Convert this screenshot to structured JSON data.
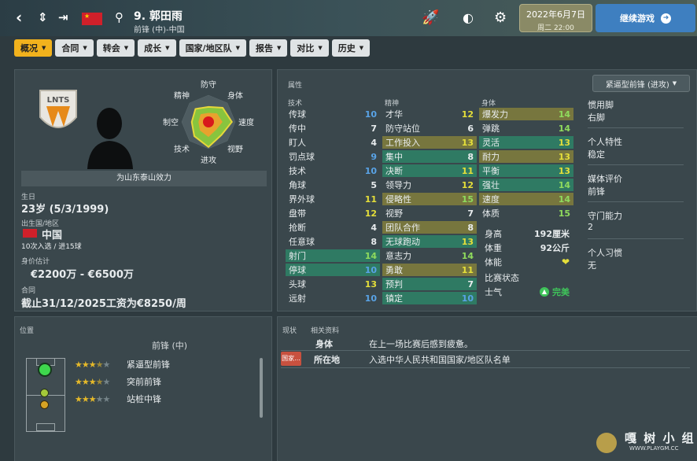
{
  "nav": {
    "back": "‹",
    "updown": "⇕",
    "last": "⇥"
  },
  "player": {
    "name": "9. 郭田雨",
    "subtitle": "前锋 (中)-中国"
  },
  "date": {
    "line1": "2022年6月7日",
    "line2": "周二 22:00"
  },
  "continue": {
    "label": "继续游戏"
  },
  "tabs": [
    "概况",
    "合同",
    "转会",
    "成长",
    "国家/地区队",
    "报告",
    "对比",
    "历史"
  ],
  "left": {
    "club_label": "为山东泰山效力",
    "logo_text": "LNTS",
    "age_title": "生日",
    "age_value": "23岁 (5/3/1999)",
    "nation_title": "出生国/地区",
    "nation_value": "中国",
    "caps": "10次入选 / 进15球",
    "value_title": "身价估计",
    "value": "€2200万 - €6500万",
    "contract_title": "合同",
    "contract": "截止31/12/2025工资为€8250/周"
  },
  "radar": {
    "labels": [
      "防守",
      "身体",
      "速度",
      "视野",
      "进攻",
      "技术",
      "制空",
      "精神"
    ],
    "values": [
      0.45,
      0.6,
      0.7,
      0.55,
      0.75,
      0.6,
      0.5,
      0.55
    ]
  },
  "attributes": {
    "title": "属性",
    "role_select": "紧逼型前锋 (进攻)",
    "technical_title": "技术",
    "technical": [
      {
        "name": "传球",
        "value": "10",
        "color": "b",
        "hl": ""
      },
      {
        "name": "传中",
        "value": "7",
        "color": "w",
        "hl": ""
      },
      {
        "name": "盯人",
        "value": "4",
        "color": "w",
        "hl": ""
      },
      {
        "name": "罚点球",
        "value": "9",
        "color": "b",
        "hl": ""
      },
      {
        "name": "技术",
        "value": "10",
        "color": "b",
        "hl": ""
      },
      {
        "name": "角球",
        "value": "5",
        "color": "w",
        "hl": ""
      },
      {
        "name": "界外球",
        "value": "11",
        "color": "y",
        "hl": ""
      },
      {
        "name": "盘带",
        "value": "12",
        "color": "y",
        "hl": ""
      },
      {
        "name": "抢断",
        "value": "4",
        "color": "w",
        "hl": ""
      },
      {
        "name": "任意球",
        "value": "8",
        "color": "w",
        "hl": ""
      },
      {
        "name": "射门",
        "value": "14",
        "color": "g",
        "hl": "green"
      },
      {
        "name": "停球",
        "value": "10",
        "color": "b",
        "hl": "green"
      },
      {
        "name": "头球",
        "value": "13",
        "color": "y",
        "hl": ""
      },
      {
        "name": "远射",
        "value": "10",
        "color": "b",
        "hl": ""
      }
    ],
    "mental_title": "精神",
    "mental": [
      {
        "name": "才华",
        "value": "12",
        "color": "y",
        "hl": ""
      },
      {
        "name": "防守站位",
        "value": "6",
        "color": "w",
        "hl": ""
      },
      {
        "name": "工作投入",
        "value": "13",
        "color": "y",
        "hl": "yellow"
      },
      {
        "name": "集中",
        "value": "8",
        "color": "w",
        "hl": "green"
      },
      {
        "name": "决断",
        "value": "11",
        "color": "y",
        "hl": "green"
      },
      {
        "name": "领导力",
        "value": "12",
        "color": "y",
        "hl": ""
      },
      {
        "name": "侵略性",
        "value": "15",
        "color": "g",
        "hl": "yellow"
      },
      {
        "name": "视野",
        "value": "7",
        "color": "w",
        "hl": ""
      },
      {
        "name": "团队合作",
        "value": "8",
        "color": "w",
        "hl": "yellow"
      },
      {
        "name": "无球跑动",
        "value": "13",
        "color": "y",
        "hl": "green"
      },
      {
        "name": "意志力",
        "value": "14",
        "color": "g",
        "hl": ""
      },
      {
        "name": "勇敢",
        "value": "11",
        "color": "y",
        "hl": "yellow"
      },
      {
        "name": "预判",
        "value": "7",
        "color": "w",
        "hl": "green"
      },
      {
        "name": "镇定",
        "value": "10",
        "color": "b",
        "hl": "green"
      }
    ],
    "physical_title": "身体",
    "physical": [
      {
        "name": "爆发力",
        "value": "14",
        "color": "g",
        "hl": "yellow"
      },
      {
        "name": "弹跳",
        "value": "14",
        "color": "g",
        "hl": ""
      },
      {
        "name": "灵活",
        "value": "13",
        "color": "y",
        "hl": "green"
      },
      {
        "name": "耐力",
        "value": "13",
        "color": "y",
        "hl": "yellow"
      },
      {
        "name": "平衡",
        "value": "13",
        "color": "y",
        "hl": "green"
      },
      {
        "name": "强壮",
        "value": "14",
        "color": "g",
        "hl": "green"
      },
      {
        "name": "速度",
        "value": "14",
        "color": "g",
        "hl": "yellow"
      },
      {
        "name": "体质",
        "value": "15",
        "color": "g",
        "hl": ""
      }
    ],
    "height_label": "身高",
    "height": "192厘米",
    "weight_label": "体重",
    "weight": "92公斤",
    "fitness_label": "体能",
    "match_label": "比赛状态",
    "morale_label": "士气",
    "morale": "完美"
  },
  "side": {
    "foot_label": "惯用脚",
    "foot": "右脚",
    "trait_label": "个人特性",
    "trait": "稳定",
    "media_label": "媒体评价",
    "media": "前锋",
    "gk_label": "守门能力",
    "gk": "2",
    "habit_label": "个人习惯",
    "habit": "无"
  },
  "position": {
    "title": "位置",
    "main": "前锋 (中)",
    "roles": [
      {
        "name": "紧逼型前锋",
        "stars": "★★★",
        "half": "★",
        "empty": "★"
      },
      {
        "name": "突前前锋",
        "stars": "★★★",
        "half": "★",
        "empty": "★"
      },
      {
        "name": "站桩中锋",
        "stars": "★★★",
        "half": "",
        "empty": "★★"
      }
    ]
  },
  "status": {
    "title": "现状",
    "related": "相关资料",
    "rows": [
      {
        "label": "身体",
        "text": "在上一场比赛后感到疲惫。"
      },
      {
        "label": "所在地",
        "text": "入选中华人民共和国国家/地区队名单"
      }
    ],
    "badge": "国家..."
  },
  "watermark": {
    "brand": "嘎 树 小 组",
    "url": "WWW.PLAYGM.CC"
  }
}
